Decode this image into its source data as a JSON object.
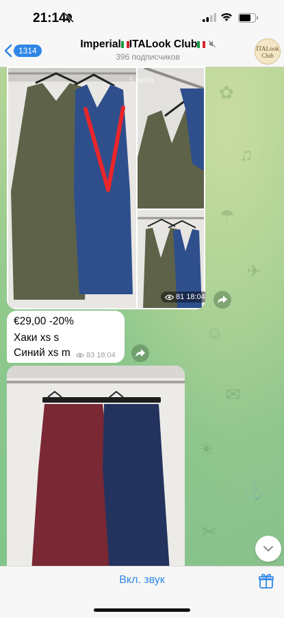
{
  "status_bar": {
    "time": "21:14"
  },
  "header": {
    "back_count": "1314",
    "title_text_1": "Imperial",
    "title_text_2": "ITALook Club",
    "subtitle": "396 подписчиков",
    "avatar_text_1": "ITALook",
    "avatar_text_2": "Club"
  },
  "album": {
    "date_overlay": "6 июля",
    "views": "81",
    "time": "18:04"
  },
  "text_message": {
    "line1": "€29,00 -20%",
    "line2": "Хаки xs s",
    "line3": "Синий xs m",
    "views": "83",
    "time": "18:04"
  },
  "bottom_bar": {
    "unmute_label": "Вкл. звук"
  },
  "colors": {
    "accent": "#2f86e6",
    "khaki_dress": "#5e6248",
    "blue_dress": "#2e4f8c",
    "burgundy_skirt": "#7a2834",
    "navy_skirt": "#23335e",
    "annotation_red": "#e8262c"
  }
}
